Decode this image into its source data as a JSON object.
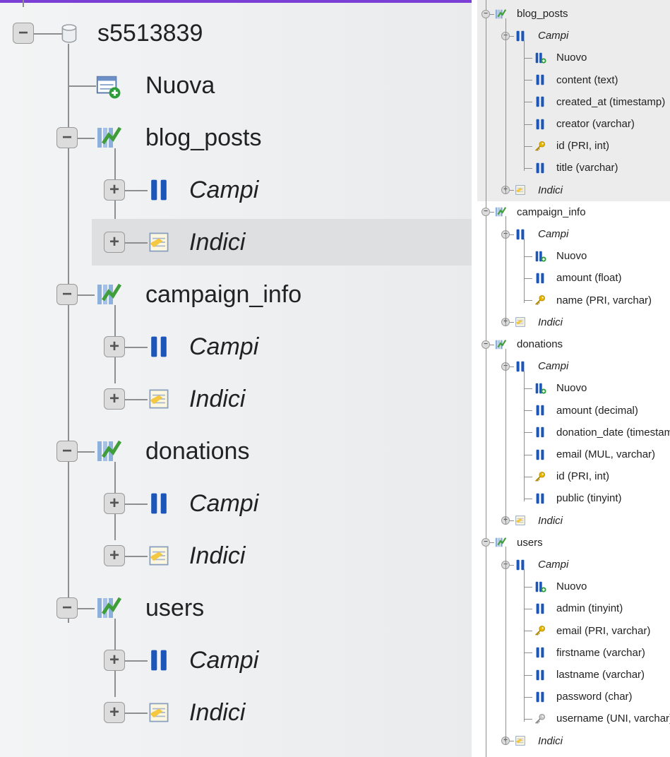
{
  "left_tree": {
    "database": "s5513839",
    "new_label": "Nuova",
    "tables": [
      {
        "name": "blog_posts",
        "fields_label": "Campi",
        "indexes_label": "Indici",
        "highlight_indexes": true
      },
      {
        "name": "campaign_info",
        "fields_label": "Campi",
        "indexes_label": "Indici"
      },
      {
        "name": "donations",
        "fields_label": "Campi",
        "indexes_label": "Indici"
      },
      {
        "name": "users",
        "fields_label": "Campi",
        "indexes_label": "Indici"
      }
    ]
  },
  "right_tree": {
    "tables": [
      {
        "name": "blog_posts",
        "fields_label": "Campi",
        "new_label": "Nuovo",
        "indexes_label": "Indici",
        "columns": [
          {
            "label": "content (text)",
            "key": false
          },
          {
            "label": "created_at (timestamp)",
            "key": false
          },
          {
            "label": "creator (varchar)",
            "key": false
          },
          {
            "label": "id (PRI, int)",
            "key": "primary"
          },
          {
            "label": "title (varchar)",
            "key": false
          }
        ]
      },
      {
        "name": "campaign_info",
        "fields_label": "Campi",
        "new_label": "Nuovo",
        "indexes_label": "Indici",
        "columns": [
          {
            "label": "amount (float)",
            "key": false
          },
          {
            "label": "name (PRI, varchar)",
            "key": "primary"
          }
        ]
      },
      {
        "name": "donations",
        "fields_label": "Campi",
        "new_label": "Nuovo",
        "indexes_label": "Indici",
        "columns": [
          {
            "label": "amount (decimal)",
            "key": false
          },
          {
            "label": "donation_date (timestamp)",
            "key": false
          },
          {
            "label": "email (MUL, varchar)",
            "key": false
          },
          {
            "label": "id (PRI, int)",
            "key": "primary"
          },
          {
            "label": "public (tinyint)",
            "key": false
          }
        ]
      },
      {
        "name": "users",
        "fields_label": "Campi",
        "new_label": "Nuovo",
        "indexes_label": "Indici",
        "columns": [
          {
            "label": "admin (tinyint)",
            "key": false
          },
          {
            "label": "email (PRI, varchar)",
            "key": "primary"
          },
          {
            "label": "firstname (varchar)",
            "key": false
          },
          {
            "label": "lastname (varchar)",
            "key": false
          },
          {
            "label": "password (char)",
            "key": false
          },
          {
            "label": "username (UNI, varchar)",
            "key": "unique"
          }
        ]
      }
    ]
  },
  "colors": {
    "accent_bar": "#7b3fd6",
    "field_blue": "#1c56b8",
    "table_green": "#3f9d3a",
    "key_gold": "#e6b800",
    "highlight": "#dedfe1"
  }
}
